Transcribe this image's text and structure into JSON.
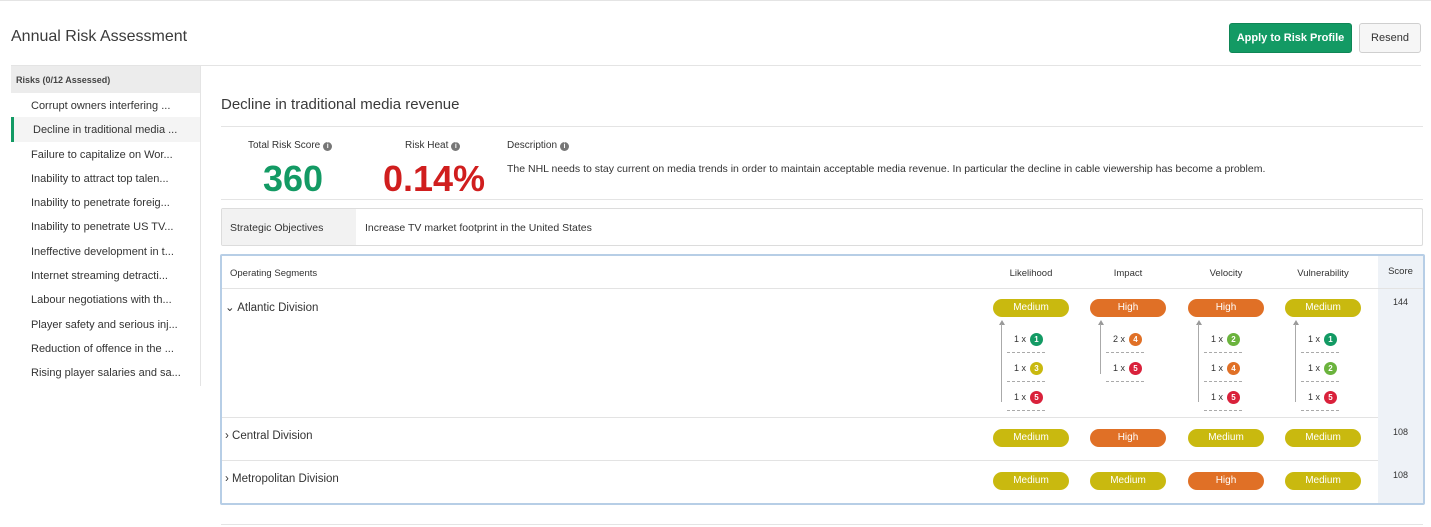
{
  "header": {
    "title": "Annual Risk Assessment",
    "apply_label": "Apply to Risk Profile",
    "resend_label": "Resend"
  },
  "sidebar": {
    "heading": "Risks (0/12 Assessed)",
    "items": [
      {
        "label": "Corrupt owners interfering ..."
      },
      {
        "label": "Decline in traditional media ..."
      },
      {
        "label": "Failure to capitalize on Wor..."
      },
      {
        "label": "Inability to attract top talen..."
      },
      {
        "label": "Inability to penetrate foreig..."
      },
      {
        "label": "Inability to penetrate US TV..."
      },
      {
        "label": "Ineffective development in t..."
      },
      {
        "label": "Internet streaming detracti..."
      },
      {
        "label": "Labour negotiations with th..."
      },
      {
        "label": "Player safety and serious inj..."
      },
      {
        "label": "Reduction of offence in the ..."
      },
      {
        "label": "Rising player salaries and sa..."
      }
    ]
  },
  "risk": {
    "title": "Decline in traditional media revenue",
    "total_score_label": "Total Risk Score",
    "total_score": "360",
    "heat_label": "Risk Heat",
    "heat": "0.14%",
    "description_label": "Description",
    "description": "The NHL needs to stay current on media trends in order to maintain acceptable media revenue. In particular the decline in cable viewership has become a problem.",
    "objectives_label": "Strategic Objectives",
    "objectives_value": "Increase TV market footprint in the United States"
  },
  "segments": {
    "columns": {
      "segments": "Operating Segments",
      "likelihood": "Likelihood",
      "impact": "Impact",
      "velocity": "Velocity",
      "vulnerability": "Vulnerability",
      "score": "Score"
    },
    "rows": [
      {
        "name": "Atlantic Division",
        "likelihood": "Medium",
        "impact": "High",
        "velocity": "High",
        "vulnerability": "Medium",
        "score": "144",
        "breakdown": {
          "likelihood": [
            {
              "mult": "1 x",
              "num": "1"
            },
            {
              "mult": "1 x",
              "num": "3"
            },
            {
              "mult": "1 x",
              "num": "5"
            }
          ],
          "impact": [
            {
              "mult": "2 x",
              "num": "4"
            },
            {
              "mult": "1 x",
              "num": "5"
            }
          ],
          "velocity": [
            {
              "mult": "1 x",
              "num": "2"
            },
            {
              "mult": "1 x",
              "num": "4"
            },
            {
              "mult": "1 x",
              "num": "5"
            }
          ],
          "vulnerability": [
            {
              "mult": "1 x",
              "num": "1"
            },
            {
              "mult": "1 x",
              "num": "2"
            },
            {
              "mult": "1 x",
              "num": "5"
            }
          ]
        }
      },
      {
        "name": "Central Division",
        "likelihood": "Medium",
        "impact": "High",
        "velocity": "Medium",
        "vulnerability": "Medium",
        "score": "108"
      },
      {
        "name": "Metropolitan Division",
        "likelihood": "Medium",
        "impact": "Medium",
        "velocity": "High",
        "vulnerability": "Medium",
        "score": "108"
      }
    ]
  },
  "colors": {
    "accent": "#139a64",
    "medium": "#c9b90f",
    "high": "#e07026",
    "score_green": "#139a64",
    "heat_red": "#d01e1e",
    "level_1": "#139a64",
    "level_2": "#6bb33d",
    "level_3": "#c9b90f",
    "level_4": "#e07026",
    "level_5": "#d9213b"
  }
}
